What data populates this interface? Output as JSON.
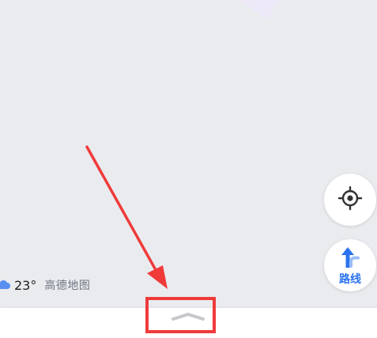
{
  "weather": {
    "icon": "cloud-icon",
    "temperature": "23°"
  },
  "brand": {
    "name": "高德地图"
  },
  "controls": {
    "locate_icon": "crosshair-icon",
    "route_icon": "turn-arrow-icon",
    "route_label": "路线"
  },
  "bottom_sheet": {
    "handle_icon": "chevron-up-icon"
  },
  "annotation": {
    "color": "#f03a3a"
  },
  "colors": {
    "accent": "#2b73f0",
    "map_background": "#e9ebee"
  }
}
